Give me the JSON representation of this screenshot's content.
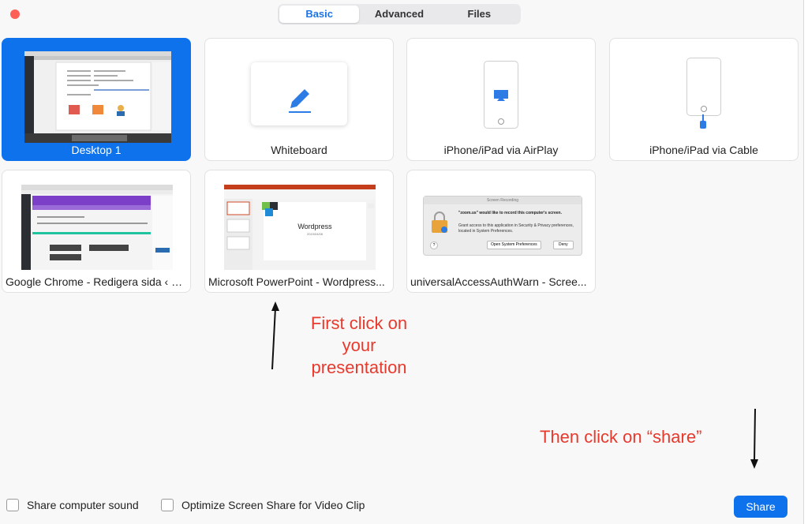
{
  "tabs": [
    "Basic",
    "Advanced",
    "Files"
  ],
  "active_tab": "Basic",
  "tiles_row1": [
    {
      "label": "Desktop 1"
    },
    {
      "label": "Whiteboard"
    },
    {
      "label": "iPhone/iPad via AirPlay"
    },
    {
      "label": "iPhone/iPad via Cable"
    }
  ],
  "tiles_row2": [
    {
      "label": "Google Chrome - Redigera sida ‹ S..."
    },
    {
      "label": "Microsoft PowerPoint - Wordpress..."
    },
    {
      "label": "universalAccessAuthWarn - Scree..."
    }
  ],
  "ppt_thumb": {
    "title": "Wordpress",
    "date": "2019/04/08"
  },
  "auth_dialog": {
    "header": "Screen Recording",
    "title": "\"zoom.us\" would like to record this computer's screen.",
    "body": "Grant access to this application in Security & Privacy preferences, located in System Preferences.",
    "open_btn": "Open System Preferences",
    "deny_btn": "Deny",
    "help": "?"
  },
  "annotations": {
    "first": [
      "First click on",
      "your",
      "presentation"
    ],
    "then": "Then click on “share”"
  },
  "footer": {
    "share_sound": "Share computer sound",
    "optimize": "Optimize Screen Share for Video Clip",
    "share_button": "Share"
  },
  "colors": {
    "accent": "#0e72ed",
    "annotation": "#e8392d"
  }
}
